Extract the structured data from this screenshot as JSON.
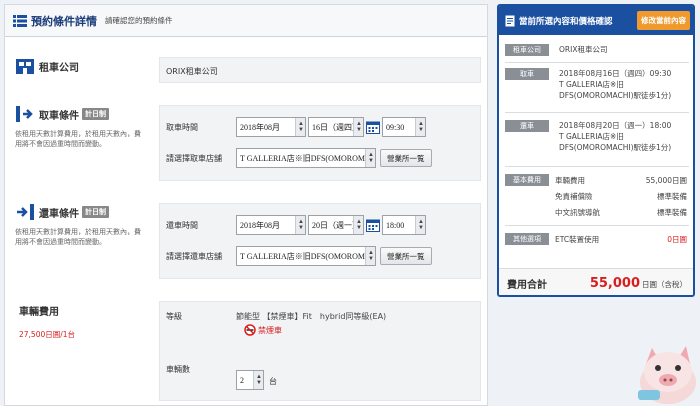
{
  "header": {
    "title": "預約條件詳情",
    "subtitle": "請確認您的預約條件"
  },
  "company": {
    "title": "租車公司",
    "value": "ORIX租車公司"
  },
  "pickup": {
    "title": "取車條件",
    "tag": "計日制",
    "note": "依租用天數計算費用，於租用天數內，費用將不會因過重時間而變動。",
    "time_label": "取車時間",
    "month": "2018年08月",
    "day": "16日（週四）",
    "time": "09:30",
    "store_label": "請選擇取車店舖",
    "store": "T GALLERIA店※旧DFS(OMOROMACHI)",
    "store_btn": "營業所一覧"
  },
  "dropoff": {
    "title": "還車條件",
    "tag": "計日制",
    "note": "依租用天數計算費用，於租用天數內，費用將不會因過重時間而變動。",
    "time_label": "還車時間",
    "month": "2018年08月",
    "day": "20日（週一）",
    "time": "18:00",
    "store_label": "請選擇還車店舖",
    "store": "T GALLERIA店※旧DFS(OMOROMACHI)",
    "store_btn": "營業所一覧"
  },
  "vehicle": {
    "title": "車輛費用",
    "price": "27,500日圓/1台",
    "grade_label": "等級",
    "grade_value": "節能型 【禁煙車】Fit　hybrid同等級(EA)",
    "no_smoking": "禁煙車",
    "count_label": "車輛數",
    "count": "2",
    "count_unit": "台"
  },
  "summary": {
    "title": "當前所選內容和價格確認",
    "edit_btn": "修改當前內容",
    "company_tag": "租車公司",
    "company": "ORIX租車公司",
    "pickup_tag": "取車",
    "pickup_line1": "2018年08月16日（週四）09:30",
    "pickup_line2": "T GALLERIA店※旧",
    "pickup_line3": "DFS(OMOROMACHI)駅徒歩1分)",
    "dropoff_tag": "還車",
    "dropoff_line1": "2018年08月20日（週一）18:00",
    "dropoff_line2": "T GALLERIA店※旧",
    "dropoff_line3": "DFS(OMOROMACHI)駅徒歩1分)",
    "basic_tag": "基本費用",
    "fees": [
      {
        "name": "車輛費用",
        "value": "55,000日圓"
      },
      {
        "name": "免責補償險",
        "value": "標準裝備"
      },
      {
        "name": "中文訊號導航",
        "value": "標準裝備"
      }
    ],
    "other_tag": "其他選項",
    "etc_name": "ETC裝置使用",
    "etc_value": "0日圓",
    "total_label": "費用合計",
    "total_value": "55,000",
    "total_unit": "日圓（含稅）"
  },
  "colors": {
    "brand_blue": "#1b4fa0",
    "accent_orange": "#f09a2e",
    "price_red": "#d81e1e"
  }
}
